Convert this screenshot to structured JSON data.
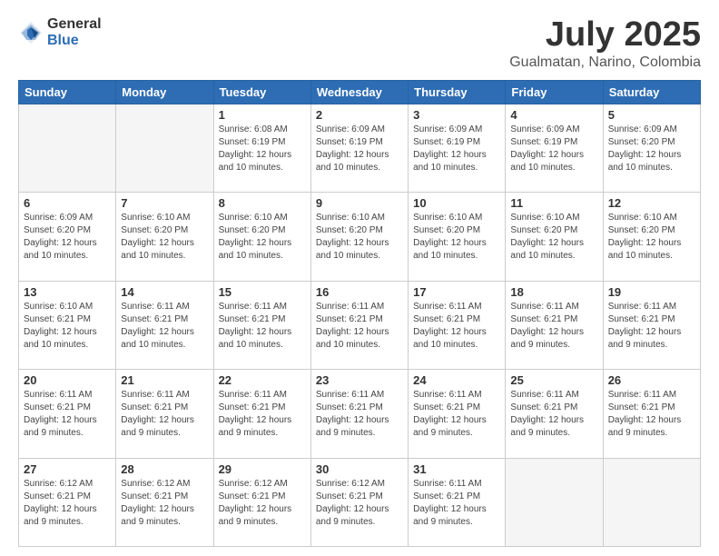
{
  "logo": {
    "general": "General",
    "blue": "Blue"
  },
  "header": {
    "title": "July 2025",
    "subtitle": "Gualmatan, Narino, Colombia"
  },
  "weekdays": [
    "Sunday",
    "Monday",
    "Tuesday",
    "Wednesday",
    "Thursday",
    "Friday",
    "Saturday"
  ],
  "weeks": [
    [
      {
        "day": "",
        "info": ""
      },
      {
        "day": "",
        "info": ""
      },
      {
        "day": "1",
        "info": "Sunrise: 6:08 AM\nSunset: 6:19 PM\nDaylight: 12 hours and 10 minutes."
      },
      {
        "day": "2",
        "info": "Sunrise: 6:09 AM\nSunset: 6:19 PM\nDaylight: 12 hours and 10 minutes."
      },
      {
        "day": "3",
        "info": "Sunrise: 6:09 AM\nSunset: 6:19 PM\nDaylight: 12 hours and 10 minutes."
      },
      {
        "day": "4",
        "info": "Sunrise: 6:09 AM\nSunset: 6:19 PM\nDaylight: 12 hours and 10 minutes."
      },
      {
        "day": "5",
        "info": "Sunrise: 6:09 AM\nSunset: 6:20 PM\nDaylight: 12 hours and 10 minutes."
      }
    ],
    [
      {
        "day": "6",
        "info": "Sunrise: 6:09 AM\nSunset: 6:20 PM\nDaylight: 12 hours and 10 minutes."
      },
      {
        "day": "7",
        "info": "Sunrise: 6:10 AM\nSunset: 6:20 PM\nDaylight: 12 hours and 10 minutes."
      },
      {
        "day": "8",
        "info": "Sunrise: 6:10 AM\nSunset: 6:20 PM\nDaylight: 12 hours and 10 minutes."
      },
      {
        "day": "9",
        "info": "Sunrise: 6:10 AM\nSunset: 6:20 PM\nDaylight: 12 hours and 10 minutes."
      },
      {
        "day": "10",
        "info": "Sunrise: 6:10 AM\nSunset: 6:20 PM\nDaylight: 12 hours and 10 minutes."
      },
      {
        "day": "11",
        "info": "Sunrise: 6:10 AM\nSunset: 6:20 PM\nDaylight: 12 hours and 10 minutes."
      },
      {
        "day": "12",
        "info": "Sunrise: 6:10 AM\nSunset: 6:20 PM\nDaylight: 12 hours and 10 minutes."
      }
    ],
    [
      {
        "day": "13",
        "info": "Sunrise: 6:10 AM\nSunset: 6:21 PM\nDaylight: 12 hours and 10 minutes."
      },
      {
        "day": "14",
        "info": "Sunrise: 6:11 AM\nSunset: 6:21 PM\nDaylight: 12 hours and 10 minutes."
      },
      {
        "day": "15",
        "info": "Sunrise: 6:11 AM\nSunset: 6:21 PM\nDaylight: 12 hours and 10 minutes."
      },
      {
        "day": "16",
        "info": "Sunrise: 6:11 AM\nSunset: 6:21 PM\nDaylight: 12 hours and 10 minutes."
      },
      {
        "day": "17",
        "info": "Sunrise: 6:11 AM\nSunset: 6:21 PM\nDaylight: 12 hours and 10 minutes."
      },
      {
        "day": "18",
        "info": "Sunrise: 6:11 AM\nSunset: 6:21 PM\nDaylight: 12 hours and 9 minutes."
      },
      {
        "day": "19",
        "info": "Sunrise: 6:11 AM\nSunset: 6:21 PM\nDaylight: 12 hours and 9 minutes."
      }
    ],
    [
      {
        "day": "20",
        "info": "Sunrise: 6:11 AM\nSunset: 6:21 PM\nDaylight: 12 hours and 9 minutes."
      },
      {
        "day": "21",
        "info": "Sunrise: 6:11 AM\nSunset: 6:21 PM\nDaylight: 12 hours and 9 minutes."
      },
      {
        "day": "22",
        "info": "Sunrise: 6:11 AM\nSunset: 6:21 PM\nDaylight: 12 hours and 9 minutes."
      },
      {
        "day": "23",
        "info": "Sunrise: 6:11 AM\nSunset: 6:21 PM\nDaylight: 12 hours and 9 minutes."
      },
      {
        "day": "24",
        "info": "Sunrise: 6:11 AM\nSunset: 6:21 PM\nDaylight: 12 hours and 9 minutes."
      },
      {
        "day": "25",
        "info": "Sunrise: 6:11 AM\nSunset: 6:21 PM\nDaylight: 12 hours and 9 minutes."
      },
      {
        "day": "26",
        "info": "Sunrise: 6:11 AM\nSunset: 6:21 PM\nDaylight: 12 hours and 9 minutes."
      }
    ],
    [
      {
        "day": "27",
        "info": "Sunrise: 6:12 AM\nSunset: 6:21 PM\nDaylight: 12 hours and 9 minutes."
      },
      {
        "day": "28",
        "info": "Sunrise: 6:12 AM\nSunset: 6:21 PM\nDaylight: 12 hours and 9 minutes."
      },
      {
        "day": "29",
        "info": "Sunrise: 6:12 AM\nSunset: 6:21 PM\nDaylight: 12 hours and 9 minutes."
      },
      {
        "day": "30",
        "info": "Sunrise: 6:12 AM\nSunset: 6:21 PM\nDaylight: 12 hours and 9 minutes."
      },
      {
        "day": "31",
        "info": "Sunrise: 6:11 AM\nSunset: 6:21 PM\nDaylight: 12 hours and 9 minutes."
      },
      {
        "day": "",
        "info": ""
      },
      {
        "day": "",
        "info": ""
      }
    ]
  ]
}
